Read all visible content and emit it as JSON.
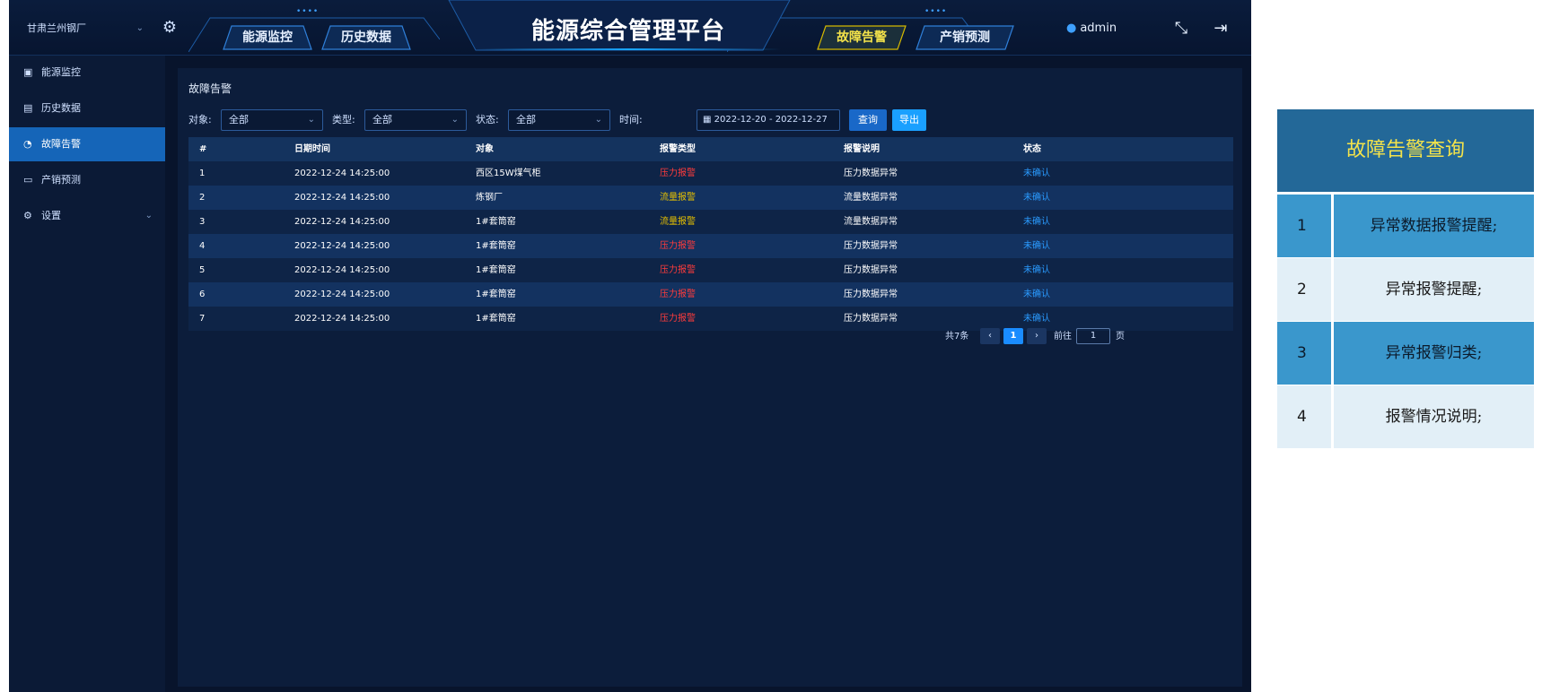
{
  "header": {
    "plant": "甘肃兰州钢厂",
    "title": "能源综合管理平台",
    "nav_left": [
      "能源监控",
      "历史数据"
    ],
    "nav_right": [
      "故障告警",
      "产销预测"
    ],
    "user": "admin"
  },
  "sidebar": {
    "items": [
      {
        "label": "能源监控",
        "icon": "monitor-icon"
      },
      {
        "label": "历史数据",
        "icon": "history-icon"
      },
      {
        "label": "故障告警",
        "icon": "alarm-icon",
        "active": true
      },
      {
        "label": "产销预测",
        "icon": "forecast-icon"
      },
      {
        "label": "设置",
        "icon": "settings-icon"
      }
    ]
  },
  "main": {
    "page_title": "故障告警",
    "filters": {
      "object_label": "对象:",
      "object_value": "全部",
      "type_label": "类型:",
      "type_value": "全部",
      "status_label": "状态:",
      "status_value": "全部",
      "time_label": "时间:",
      "date_start": "2022-12-20",
      "date_sep": "-",
      "date_end": "2022-12-27"
    },
    "buttons": {
      "query": "查询",
      "export": "导出"
    },
    "table": {
      "headers": [
        "#",
        "日期时间",
        "对象",
        "报警类型",
        "报警说明",
        "状态"
      ],
      "rows": [
        {
          "no": "1",
          "time": "2022-12-24 14:25:00",
          "object": "西区15W煤气柜",
          "type": "压力报警",
          "type_color": "red",
          "desc": "压力数据异常",
          "status": "未确认"
        },
        {
          "no": "2",
          "time": "2022-12-24 14:25:00",
          "object": "炼钢厂",
          "type": "流量报警",
          "type_color": "yellow",
          "desc": "流量数据异常",
          "status": "未确认"
        },
        {
          "no": "3",
          "time": "2022-12-24 14:25:00",
          "object": "1#套筒窑",
          "type": "流量报警",
          "type_color": "yellow",
          "desc": "流量数据异常",
          "status": "未确认"
        },
        {
          "no": "4",
          "time": "2022-12-24 14:25:00",
          "object": "1#套筒窑",
          "type": "压力报警",
          "type_color": "red",
          "desc": "压力数据异常",
          "status": "未确认"
        },
        {
          "no": "5",
          "time": "2022-12-24 14:25:00",
          "object": "1#套筒窑",
          "type": "压力报警",
          "type_color": "red",
          "desc": "压力数据异常",
          "status": "未确认"
        },
        {
          "no": "6",
          "time": "2022-12-24 14:25:00",
          "object": "1#套筒窑",
          "type": "压力报警",
          "type_color": "red",
          "desc": "压力数据异常",
          "status": "未确认"
        },
        {
          "no": "7",
          "time": "2022-12-24 14:25:00",
          "object": "1#套筒窑",
          "type": "压力报警",
          "type_color": "red",
          "desc": "压力数据异常",
          "status": "未确认"
        }
      ]
    },
    "pagination": {
      "total": "共7条",
      "prev": "‹",
      "current": "1",
      "next": "›",
      "goto_label": "前往",
      "goto_value": "1",
      "page_unit": "页"
    }
  },
  "panel": {
    "title": "故障告警查询",
    "items": [
      {
        "num": "1",
        "text": "异常数据报警提醒;"
      },
      {
        "num": "2",
        "text": "异常报警提醒;"
      },
      {
        "num": "3",
        "text": "异常报警归类;"
      },
      {
        "num": "4",
        "text": "报警情况说明;"
      }
    ]
  },
  "colors": {
    "accent": "#1a8cff",
    "alarm_red": "#ff3b3b",
    "alarm_yellow": "#e6c000",
    "panel_title": "#f4e34a"
  }
}
